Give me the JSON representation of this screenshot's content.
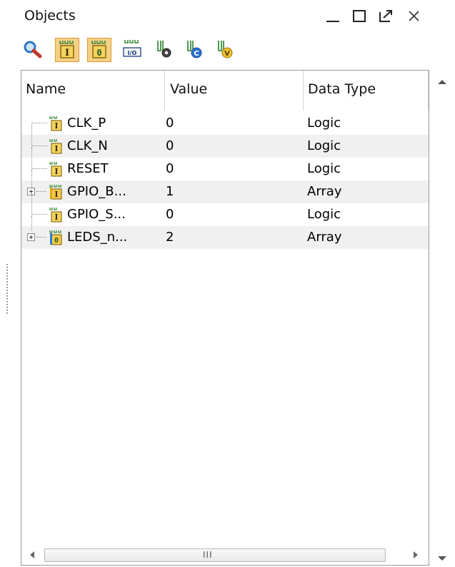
{
  "panel": {
    "title": "Objects"
  },
  "toolbar": {
    "items": [
      {
        "icon": "search-icon",
        "active": false
      },
      {
        "icon": "input-ports-icon",
        "active": true
      },
      {
        "icon": "output-ports-icon",
        "active": true
      },
      {
        "icon": "io-ports-icon",
        "active": false
      },
      {
        "icon": "internal-signals-icon",
        "active": false
      },
      {
        "icon": "constants-icon",
        "active": false
      },
      {
        "icon": "variables-icon",
        "active": false
      }
    ]
  },
  "table": {
    "columns": [
      "Name",
      "Value",
      "Data Type"
    ],
    "rows": [
      {
        "name": "CLK_P",
        "value": "0",
        "type": "Logic",
        "icon": "input-port-icon",
        "expandable": false
      },
      {
        "name": "CLK_N",
        "value": "0",
        "type": "Logic",
        "icon": "input-port-icon",
        "expandable": false
      },
      {
        "name": "RESET",
        "value": "0",
        "type": "Logic",
        "icon": "input-port-icon",
        "expandable": false
      },
      {
        "name": "GPIO_B...",
        "value": "1",
        "type": "Array",
        "icon": "input-array-icon",
        "expandable": true
      },
      {
        "name": "GPIO_S...",
        "value": "0",
        "type": "Logic",
        "icon": "input-port-icon",
        "expandable": false
      },
      {
        "name": "LEDS_n...",
        "value": "2",
        "type": "Array",
        "icon": "output-array-icon",
        "expandable": true
      }
    ]
  },
  "scrollbar": {
    "grip": "III"
  },
  "colors": {
    "toggle_active_bg": "#f6cf83",
    "toggle_active_border": "#d99a35",
    "alt_row": "#f0f0f0"
  }
}
